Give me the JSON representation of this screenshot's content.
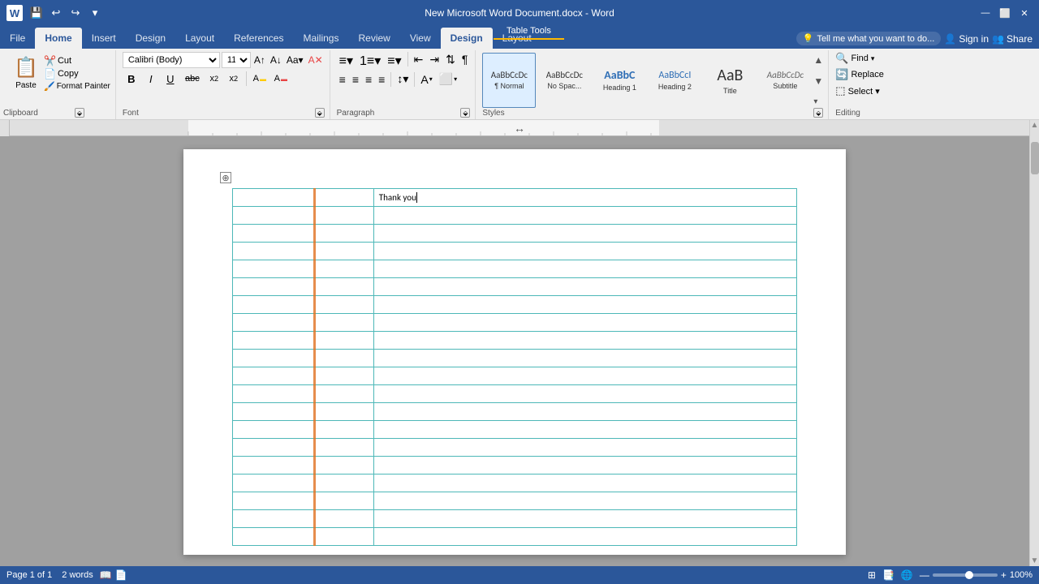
{
  "titleBar": {
    "appName": "New Microsoft Word Document.docx - Word",
    "tableTools": "Table Tools",
    "quickAccess": [
      "💾",
      "↩",
      "↪",
      "▾"
    ]
  },
  "ribbonTabs": {
    "tabs": [
      "File",
      "Home",
      "Insert",
      "Design",
      "Layout",
      "References",
      "Mailings",
      "Review",
      "View"
    ],
    "activeTab": "Home",
    "tableDesignTab": "Design",
    "tableLayoutTab": "Layout",
    "tellMe": "Tell me what you want to do...",
    "signIn": "Sign in",
    "share": "Share"
  },
  "ribbon": {
    "clipboard": {
      "label": "Clipboard",
      "paste": "Paste",
      "cut": "Cut",
      "copy": "Copy",
      "formatPainter": "Format Painter"
    },
    "font": {
      "label": "Font",
      "fontName": "Calibri (Body)",
      "fontSize": "11",
      "bold": "B",
      "italic": "I",
      "underline": "U",
      "strikethrough": "abc",
      "subscript": "x₂",
      "superscript": "x²"
    },
    "paragraph": {
      "label": "Paragraph"
    },
    "styles": {
      "label": "Styles",
      "items": [
        {
          "name": "Normal",
          "label": "¶ Normal",
          "preview": "AaBbCcDc"
        },
        {
          "name": "No Spacing",
          "label": "No Spac...",
          "preview": "AaBbCcDc"
        },
        {
          "name": "Heading 1",
          "label": "Heading 1",
          "preview": "AaBbC"
        },
        {
          "name": "Heading 2",
          "label": "Heading 2",
          "preview": "AaBbCcI"
        },
        {
          "name": "Title",
          "label": "Title",
          "preview": "AaB"
        },
        {
          "name": "Subtitle",
          "label": "Subtitle",
          "preview": "AaBbCcDc"
        }
      ]
    },
    "editing": {
      "label": "Editing",
      "find": "Find",
      "replace": "Replace",
      "select": "Select ▾"
    }
  },
  "document": {
    "tableText": "Thank you",
    "cursorVisible": true
  },
  "statusBar": {
    "page": "Page 1 of 1",
    "words": "2 words",
    "zoom": "100%"
  }
}
